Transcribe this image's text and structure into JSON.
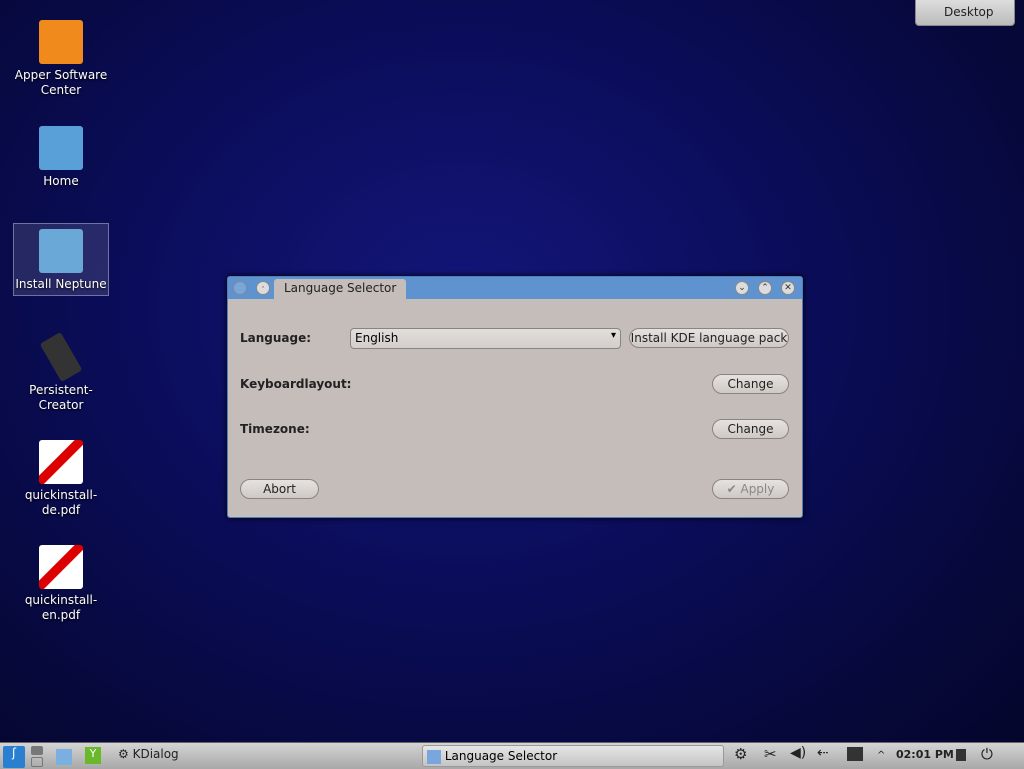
{
  "desktop_button": "Desktop",
  "desktop_icons": [
    {
      "label": "Apper Software Center",
      "color": "#f08a1c"
    },
    {
      "label": "Home",
      "color": "#5aa0d8"
    },
    {
      "label": "Install Neptune",
      "color": "#6aa8d8"
    },
    {
      "label": "Persistent-Creator",
      "color": "#333333"
    },
    {
      "label": "quickinstall-de.pdf",
      "color": "#ffffff"
    },
    {
      "label": "quickinstall-en.pdf",
      "color": "#ffffff"
    }
  ],
  "window": {
    "title": "Language Selector",
    "language_label": "Language:",
    "language_value": "English",
    "install_pack": "Install KDE language pack",
    "keyboard_label": "Keyboardlayout:",
    "timezone_label": "Timezone:",
    "change": "Change",
    "abort": "Abort",
    "apply": "Apply"
  },
  "taskbar": {
    "kdialog": "KDialog",
    "task": "Language Selector",
    "clock": "02:01 PM"
  }
}
